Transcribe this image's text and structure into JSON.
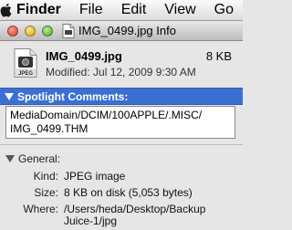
{
  "menubar": {
    "apple_icon": "apple-logo-icon",
    "items": [
      "Finder",
      "File",
      "Edit",
      "View",
      "Go"
    ]
  },
  "window": {
    "title": "IMG_0499.jpg Info",
    "traffic_lights": [
      "close-icon",
      "minimize-icon",
      "zoom-icon"
    ]
  },
  "file": {
    "name": "IMG_0499.jpg",
    "size": "8 KB",
    "modified": "Modified: Jul 12, 2009 9:30 AM",
    "icon_label": "JPEG"
  },
  "spotlight": {
    "header": "Spotlight Comments:",
    "comments_line1": "MediaDomain/DCIM/100APPLE/.MISC/",
    "comments_line2": "IMG_0499.THM"
  },
  "general": {
    "header": "General:",
    "kind_label": "Kind:",
    "kind_value": "JPEG image",
    "size_label": "Size:",
    "size_value": "8 KB on disk (5,053 bytes)",
    "where_label": "Where:",
    "where_value_line1": "/Users/heda/Desktop/Backup",
    "where_value_line2": "Juice-1/jpg"
  },
  "colors": {
    "spotlight_header_bg": "#3b6fd1",
    "window_bg": "#e6e6e6"
  }
}
